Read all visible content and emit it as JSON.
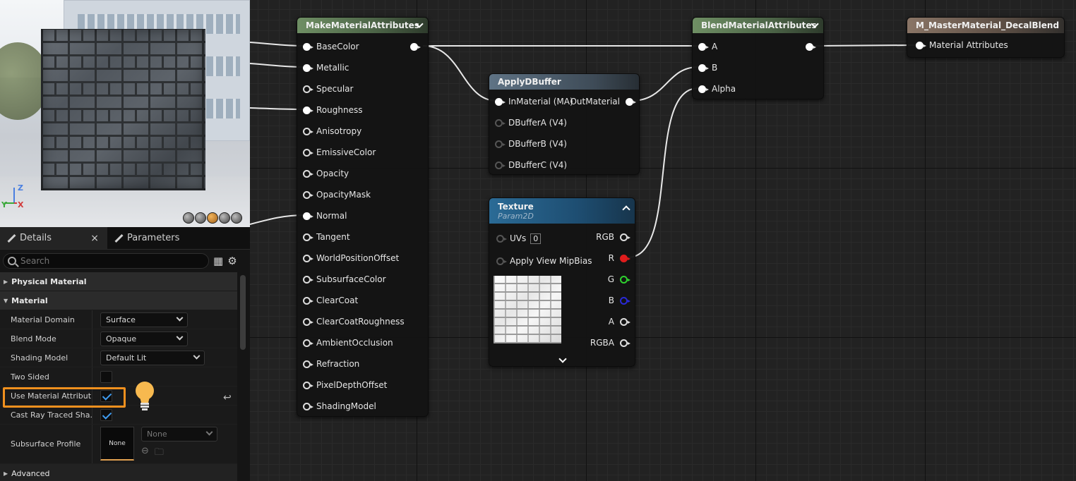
{
  "viewport": {
    "axis_z": "Z",
    "axis_y": "Y",
    "axis_x": "X",
    "view_buttons": [
      "cylinder",
      "sphere",
      "plane",
      "cube",
      "teapot"
    ]
  },
  "details": {
    "tabs": [
      {
        "label": "Details",
        "close": "×"
      },
      {
        "label": "Parameters"
      }
    ],
    "search_placeholder": "Search",
    "sections": {
      "physical_material": "Physical Material",
      "material": "Material",
      "advanced": "Advanced"
    },
    "properties": [
      {
        "label": "Material Domain",
        "value": "Surface"
      },
      {
        "label": "Blend Mode",
        "value": "Opaque"
      },
      {
        "label": "Shading Model",
        "value": "Default Lit"
      },
      {
        "label": "Two Sided",
        "checked": false
      },
      {
        "label": "Use Material Attribut...",
        "checked": true
      },
      {
        "label": "Cast Ray Traced Sha...",
        "checked": true
      },
      {
        "label": "Subsurface Profile",
        "thumbnail": "None",
        "value": "None"
      }
    ],
    "highlight_color": "#f0901e"
  },
  "graph": {
    "nodes": {
      "make": {
        "title": "MakeMaterialAttributes",
        "inputs": [
          "BaseColor",
          "Metallic",
          "Specular",
          "Roughness",
          "Anisotropy",
          "EmissiveColor",
          "Opacity",
          "OpacityMask",
          "Normal",
          "Tangent",
          "WorldPositionOffset",
          "SubsurfaceColor",
          "ClearCoat",
          "ClearCoatRoughness",
          "AmbientOcclusion",
          "Refraction",
          "PixelDepthOffset",
          "ShadingModel"
        ]
      },
      "apply": {
        "title": "ApplyDBuffer",
        "inputs": [
          "InMaterial (MA)",
          "DBufferA (V4)",
          "DBufferB (V4)",
          "DBufferC (V4)"
        ],
        "output": "OutMaterial"
      },
      "blend": {
        "title": "BlendMaterialAttributes",
        "inputs": [
          "A",
          "B",
          "Alpha"
        ]
      },
      "master": {
        "title": "M_MasterMaterial_DecalBlend",
        "inputs": [
          "Material Attributes"
        ]
      },
      "texture": {
        "title": "Texture",
        "subtitle": "Param2D",
        "inputs": [
          "UVs",
          "Apply View MipBias"
        ],
        "uv_value": "0",
        "outputs": [
          "RGB",
          "R",
          "G",
          "B",
          "A",
          "RGBA"
        ]
      }
    }
  }
}
